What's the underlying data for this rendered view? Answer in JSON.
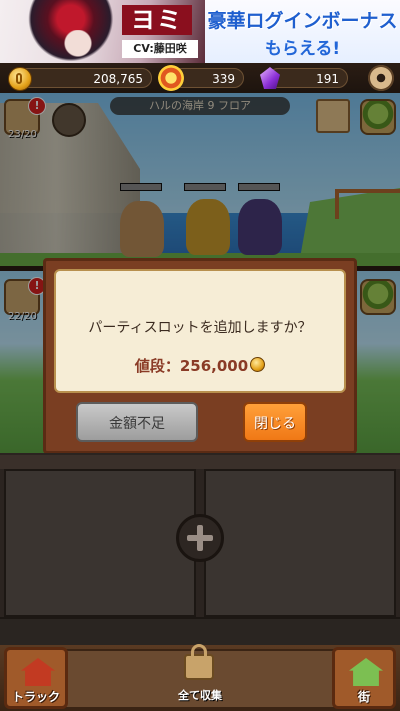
{
  "banner": {
    "hero_text": "ヨミ",
    "cv_label": "CV:藤田咲",
    "promo_line1": "豪華ログインボーナス",
    "promo_line2": "もらえる!"
  },
  "currency": {
    "gold": "208,765",
    "medals": "339",
    "gems": "191",
    "colors": {
      "gold": "#e4a21a",
      "gem": "#8b2fd6",
      "medal": "#e0581f"
    }
  },
  "field": {
    "floor_label": "ハルの海岸 9 フロア",
    "row1_count": "23/20",
    "row2_count": "22/20",
    "alert_mark": "!"
  },
  "dialog": {
    "message": "パーティスロットを追加しますか？",
    "price_label": "値段：256,000",
    "insufficient_button": "金額不足",
    "close_button": "閉じる"
  },
  "footer": {
    "truck_label": "トラック",
    "collect_label": "全て収集",
    "right_label": "街"
  },
  "icons": [
    "coin-icon",
    "medal-icon",
    "gem-icon",
    "gear-icon",
    "plus-icon",
    "lock-icon",
    "house-icon"
  ]
}
